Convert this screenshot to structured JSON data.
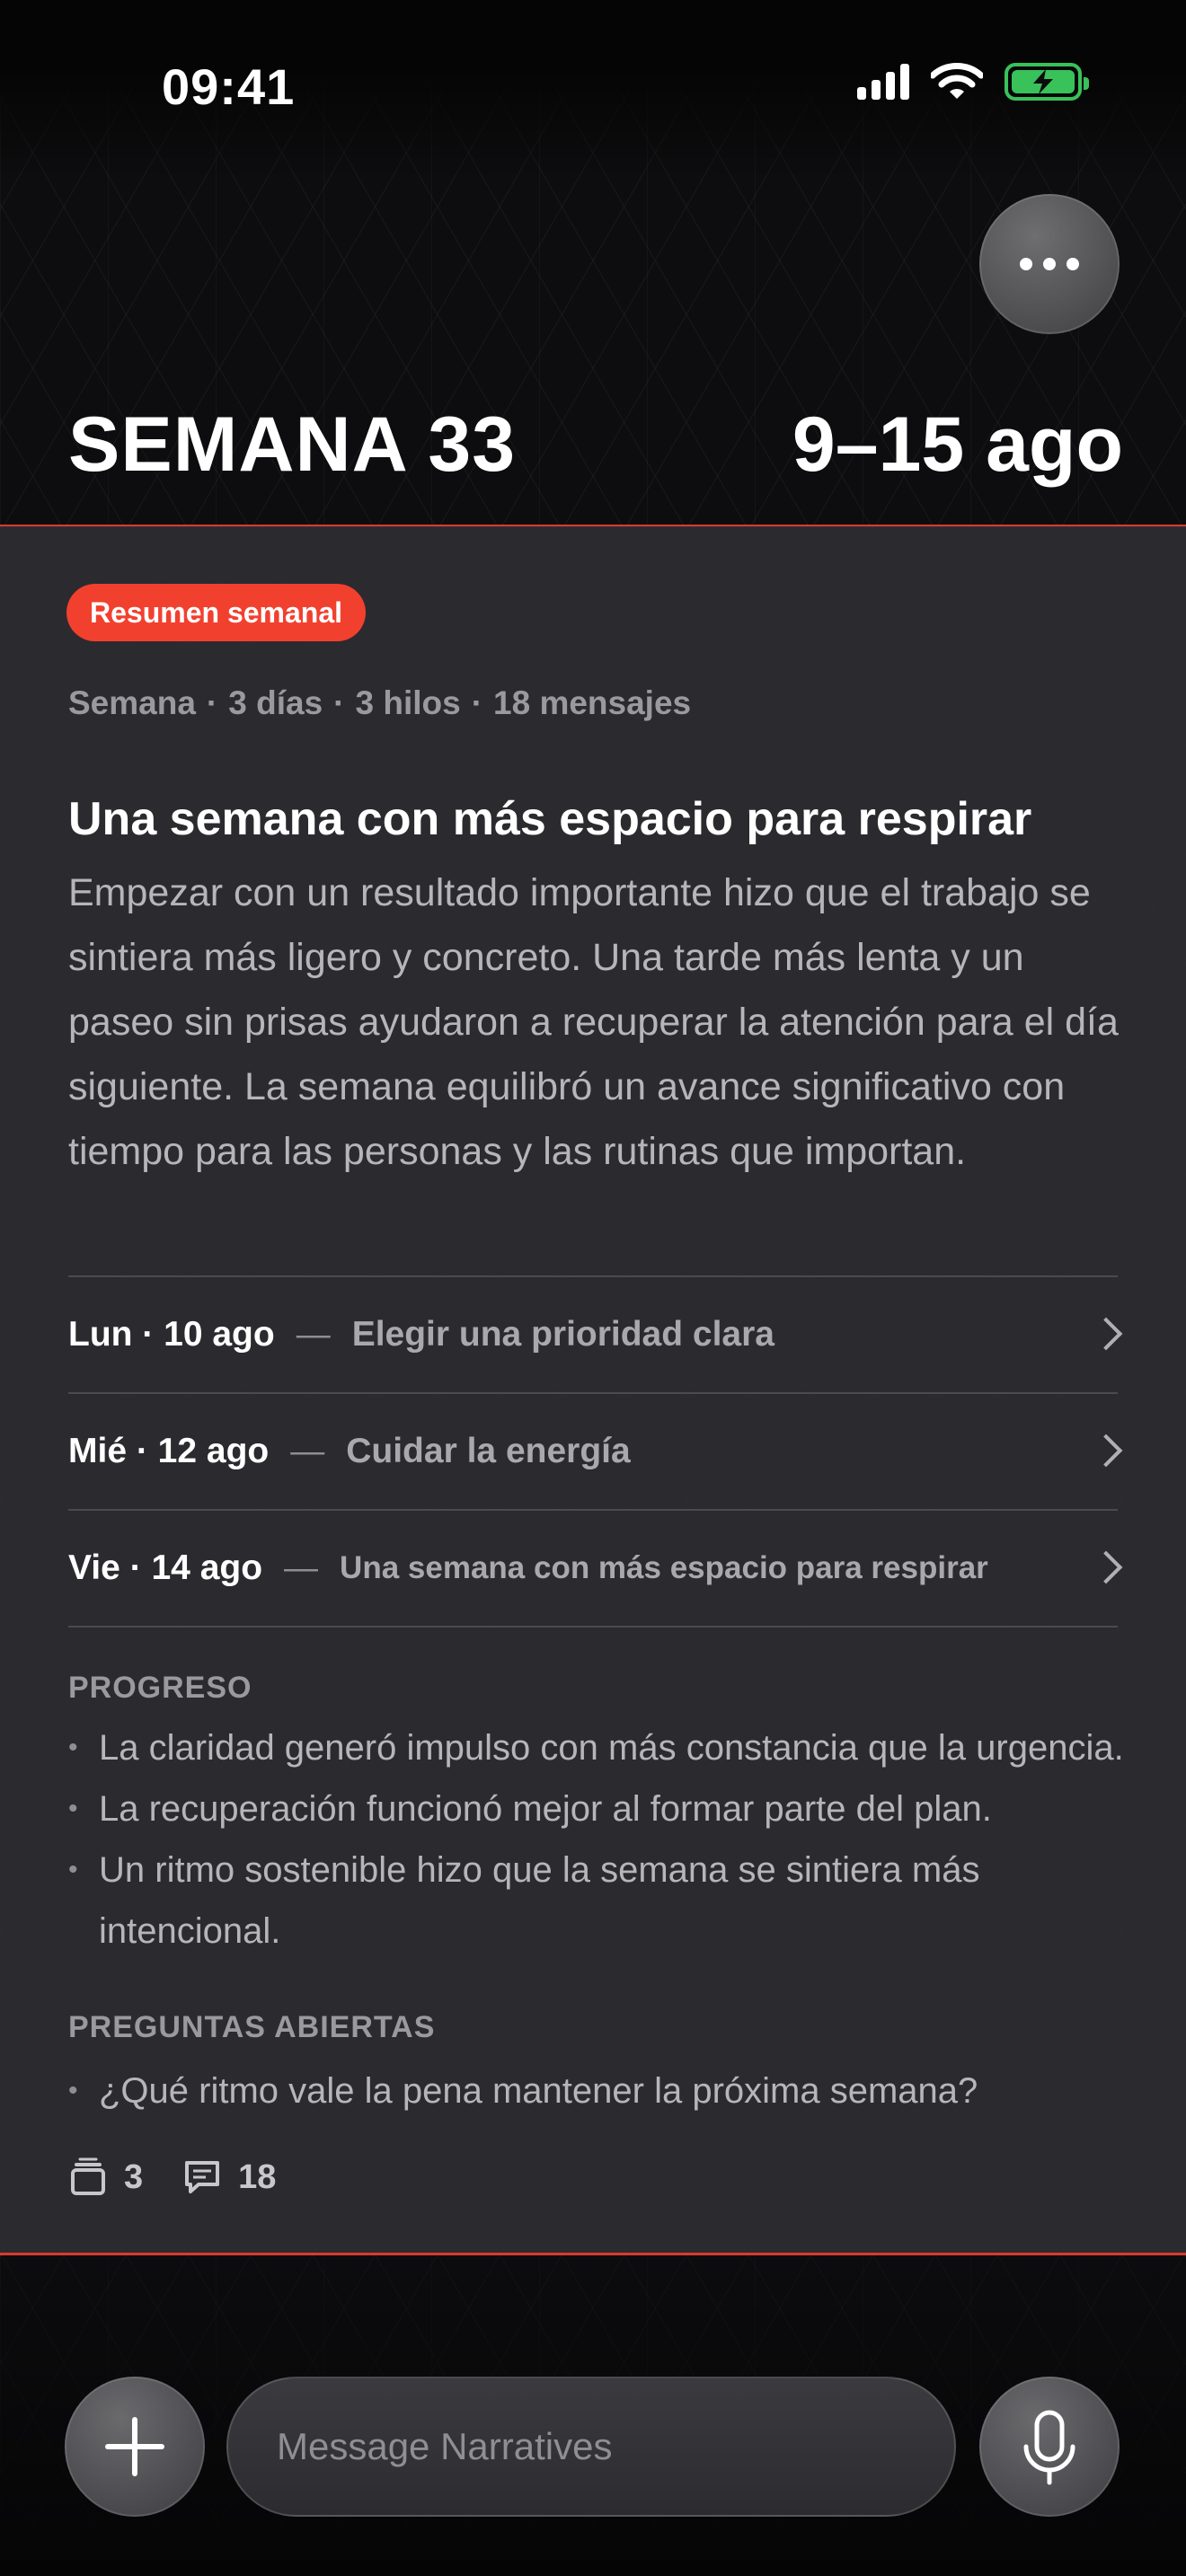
{
  "status_bar": {
    "time": "09:41"
  },
  "header": {
    "title": "SEMANA 33",
    "date_range": "9–15 ago"
  },
  "summary": {
    "badge": "Resumen semanal",
    "meta": [
      "Semana",
      "3 días",
      "3 hilos",
      "18 mensajes"
    ],
    "title": "Una semana con más espacio para respirar",
    "body": "Empezar con un resultado importante hizo que el trabajo se sintiera más ligero y concreto. Una tarde más lenta y un paseo sin prisas ayudaron a recuperar la atención para el día siguiente. La semana equilibró un avance significativo con tiempo para las personas y las rutinas que importan."
  },
  "days": [
    {
      "date": "Lun · 10 ago",
      "topic": "Elegir una prioridad clara"
    },
    {
      "date": "Mié · 12 ago",
      "topic": "Cuidar la energía"
    },
    {
      "date": "Vie · 14 ago",
      "topic": "Una semana con más espacio para respirar"
    }
  ],
  "progress": {
    "heading": "PROGRESO",
    "items": [
      "La claridad generó impulso con más constancia que la urgencia.",
      "La recuperación funcionó mejor al formar parte del plan.",
      "Un ritmo sostenible hizo que la semana se sintiera más intencional."
    ]
  },
  "open_questions": {
    "heading": "PREGUNTAS ABIERTAS",
    "items": [
      "¿Qué ritmo vale la pena mantener la próxima semana?"
    ]
  },
  "counts": {
    "threads": "3",
    "messages": "18"
  },
  "composer": {
    "placeholder": "Message Narratives"
  },
  "colors": {
    "accent": "#f2402f",
    "divider": "#d93a2e",
    "battery": "#39c15a"
  }
}
